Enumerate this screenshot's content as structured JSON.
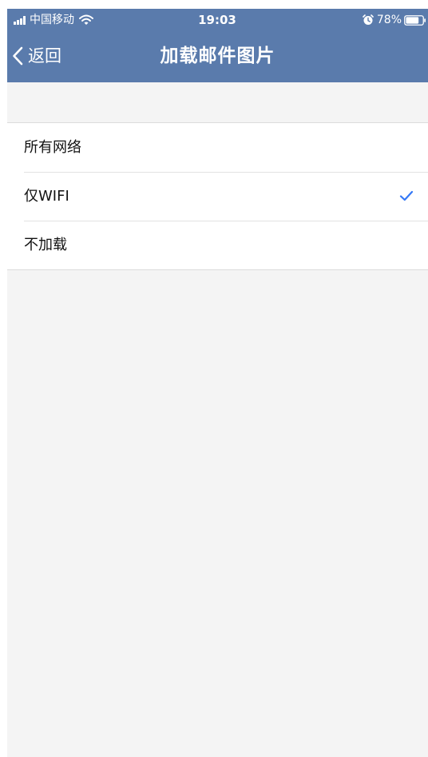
{
  "status_bar": {
    "carrier": "中国移动",
    "time": "19:03",
    "battery": "78%",
    "battery_level": 0.78,
    "icons": [
      "signal-icon",
      "wifi-icon",
      "alarm-icon",
      "battery-icon"
    ]
  },
  "nav": {
    "back_label": "返回",
    "title": "加载邮件图片"
  },
  "options": [
    {
      "label": "所有网络",
      "selected": false
    },
    {
      "label": "仅WIFI",
      "selected": true
    },
    {
      "label": "不加载",
      "selected": false
    }
  ],
  "colors": {
    "nav_background": "#5a7bac",
    "page_background": "#f4f4f4",
    "checkmark": "#3478f6"
  }
}
